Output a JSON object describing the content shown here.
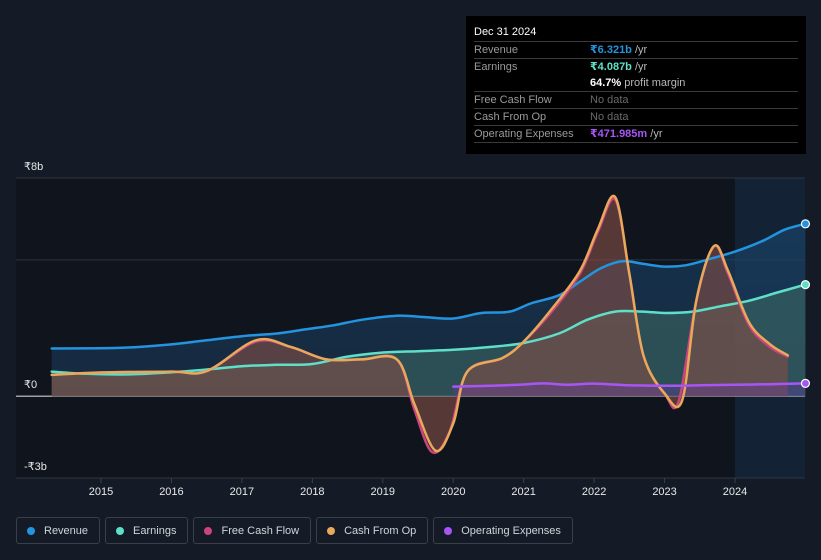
{
  "tooltip": {
    "date": "Dec 31 2024",
    "rows": [
      {
        "label": "Revenue",
        "value": "₹6.321b",
        "unit": " /yr",
        "color": "#2394df"
      },
      {
        "label": "Earnings",
        "value": "₹4.087b",
        "unit": " /yr",
        "color": "#5ee0c8"
      },
      {
        "label": "",
        "value": "64.7%",
        "unit": " profit margin",
        "color": "#ffffff"
      },
      {
        "label": "Free Cash Flow",
        "value": "No data",
        "unit": "",
        "color": "#6a6a6a"
      },
      {
        "label": "Cash From Op",
        "value": "No data",
        "unit": "",
        "color": "#6a6a6a"
      },
      {
        "label": "Operating Expenses",
        "value": "₹471.985m",
        "unit": " /yr",
        "color": "#a855f7"
      }
    ]
  },
  "legend": [
    {
      "label": "Revenue",
      "color": "#2394df"
    },
    {
      "label": "Earnings",
      "color": "#5ee0c8"
    },
    {
      "label": "Free Cash Flow",
      "color": "#c8457d"
    },
    {
      "label": "Cash From Op",
      "color": "#e8a95a"
    },
    {
      "label": "Operating Expenses",
      "color": "#a855f7"
    }
  ],
  "chart_data": {
    "type": "area",
    "title": "",
    "xlabel": "",
    "ylabel": "",
    "currency": "₹",
    "ylim": [
      -3,
      8
    ],
    "y_ticks": [
      {
        "value": 8,
        "label": "₹8b"
      },
      {
        "value": 0,
        "label": "₹0"
      },
      {
        "value": -3,
        "label": "-₹3b"
      }
    ],
    "gridlines": [
      8,
      5,
      0,
      -3
    ],
    "xlim": [
      2014.3,
      2025.0
    ],
    "x_ticks": [
      2015,
      2016,
      2017,
      2018,
      2019,
      2020,
      2021,
      2022,
      2023,
      2024
    ],
    "forecast_shade_start": 2024.0,
    "series": [
      {
        "name": "Revenue",
        "color": "#2394df",
        "unit": "b",
        "points": [
          [
            2014.3,
            1.75
          ],
          [
            2015.0,
            1.76
          ],
          [
            2015.5,
            1.8
          ],
          [
            2016.0,
            1.9
          ],
          [
            2016.5,
            2.05
          ],
          [
            2017.0,
            2.2
          ],
          [
            2017.5,
            2.3
          ],
          [
            2017.9,
            2.45
          ],
          [
            2018.3,
            2.6
          ],
          [
            2018.7,
            2.8
          ],
          [
            2019.2,
            2.95
          ],
          [
            2019.6,
            2.9
          ],
          [
            2020.0,
            2.85
          ],
          [
            2020.4,
            3.05
          ],
          [
            2020.8,
            3.1
          ],
          [
            2021.1,
            3.4
          ],
          [
            2021.5,
            3.7
          ],
          [
            2021.8,
            4.2
          ],
          [
            2022.1,
            4.7
          ],
          [
            2022.4,
            4.95
          ],
          [
            2022.7,
            4.85
          ],
          [
            2023.0,
            4.75
          ],
          [
            2023.3,
            4.8
          ],
          [
            2023.6,
            5.0
          ],
          [
            2024.0,
            5.3
          ],
          [
            2024.4,
            5.7
          ],
          [
            2024.7,
            6.1
          ],
          [
            2025.0,
            6.32
          ]
        ]
      },
      {
        "name": "Earnings",
        "color": "#5ee0c8",
        "unit": "b",
        "points": [
          [
            2014.3,
            0.9
          ],
          [
            2014.8,
            0.82
          ],
          [
            2015.4,
            0.8
          ],
          [
            2016.0,
            0.88
          ],
          [
            2016.5,
            0.98
          ],
          [
            2017.0,
            1.1
          ],
          [
            2017.5,
            1.15
          ],
          [
            2018.0,
            1.18
          ],
          [
            2018.5,
            1.45
          ],
          [
            2019.0,
            1.6
          ],
          [
            2019.5,
            1.65
          ],
          [
            2020.0,
            1.7
          ],
          [
            2020.5,
            1.8
          ],
          [
            2021.0,
            1.95
          ],
          [
            2021.5,
            2.3
          ],
          [
            2021.9,
            2.8
          ],
          [
            2022.3,
            3.1
          ],
          [
            2022.7,
            3.1
          ],
          [
            2023.0,
            3.05
          ],
          [
            2023.4,
            3.1
          ],
          [
            2023.8,
            3.3
          ],
          [
            2024.2,
            3.5
          ],
          [
            2024.6,
            3.8
          ],
          [
            2025.0,
            4.09
          ]
        ]
      },
      {
        "name": "Free Cash Flow",
        "color": "#c8457d",
        "unit": "b",
        "points": [
          [
            2014.3,
            0.78
          ],
          [
            2015.0,
            0.87
          ],
          [
            2016.0,
            0.9
          ],
          [
            2016.5,
            0.92
          ],
          [
            2017.2,
            2.0
          ],
          [
            2017.7,
            1.8
          ],
          [
            2018.2,
            1.35
          ],
          [
            2018.7,
            1.35
          ],
          [
            2019.2,
            1.35
          ],
          [
            2019.45,
            -0.5
          ],
          [
            2019.7,
            -2.05
          ],
          [
            2019.95,
            -1.3
          ],
          [
            2020.2,
            0.9
          ],
          [
            2020.7,
            1.4
          ],
          [
            2021.0,
            2.0
          ],
          [
            2021.4,
            3.1
          ],
          [
            2021.8,
            4.5
          ],
          [
            2022.05,
            6.0
          ],
          [
            2022.3,
            7.2
          ],
          [
            2022.5,
            4.5
          ],
          [
            2022.7,
            1.5
          ],
          [
            2023.0,
            0.1
          ],
          [
            2023.2,
            -0.2
          ],
          [
            2023.45,
            3.5
          ],
          [
            2023.7,
            5.5
          ],
          [
            2023.9,
            4.5
          ],
          [
            2024.2,
            2.6
          ],
          [
            2024.5,
            1.8
          ],
          [
            2024.75,
            1.45
          ]
        ]
      },
      {
        "name": "Cash From Op",
        "color": "#e8a95a",
        "unit": "b",
        "points": [
          [
            2014.3,
            0.78
          ],
          [
            2015.0,
            0.87
          ],
          [
            2016.0,
            0.9
          ],
          [
            2016.5,
            0.92
          ],
          [
            2017.2,
            2.05
          ],
          [
            2017.7,
            1.8
          ],
          [
            2018.2,
            1.35
          ],
          [
            2018.7,
            1.35
          ],
          [
            2019.2,
            1.35
          ],
          [
            2019.45,
            -0.3
          ],
          [
            2019.75,
            -2.0
          ],
          [
            2020.0,
            -1.0
          ],
          [
            2020.2,
            0.9
          ],
          [
            2020.7,
            1.4
          ],
          [
            2021.0,
            2.0
          ],
          [
            2021.4,
            3.2
          ],
          [
            2021.8,
            4.6
          ],
          [
            2022.05,
            6.1
          ],
          [
            2022.3,
            7.3
          ],
          [
            2022.5,
            4.5
          ],
          [
            2022.7,
            1.5
          ],
          [
            2023.0,
            0.1
          ],
          [
            2023.25,
            -0.15
          ],
          [
            2023.45,
            3.5
          ],
          [
            2023.7,
            5.5
          ],
          [
            2023.9,
            4.6
          ],
          [
            2024.2,
            2.7
          ],
          [
            2024.5,
            1.9
          ],
          [
            2024.75,
            1.5
          ]
        ]
      },
      {
        "name": "Operating Expenses",
        "color": "#a855f7",
        "unit": "b",
        "points": [
          [
            2020.0,
            0.35
          ],
          [
            2020.5,
            0.38
          ],
          [
            2021.0,
            0.43
          ],
          [
            2021.3,
            0.47
          ],
          [
            2021.6,
            0.42
          ],
          [
            2022.0,
            0.46
          ],
          [
            2022.5,
            0.4
          ],
          [
            2023.0,
            0.38
          ],
          [
            2023.5,
            0.4
          ],
          [
            2024.0,
            0.42
          ],
          [
            2024.5,
            0.44
          ],
          [
            2025.0,
            0.47
          ]
        ]
      }
    ]
  }
}
